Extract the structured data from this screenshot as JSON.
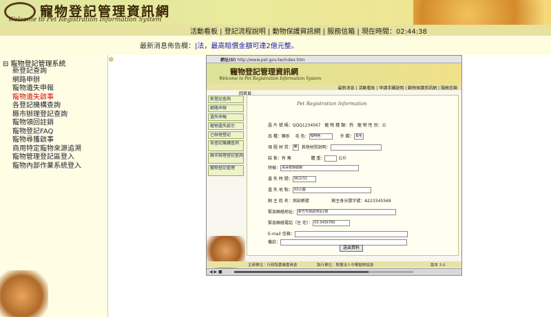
{
  "site": {
    "title": "寵物登記管理資訊網",
    "subtitle": "Welcome to Pet Registration Information System"
  },
  "nav": {
    "items": [
      "活動看板",
      "登記流程說明",
      "動物保護資訊網",
      "服務信箱"
    ],
    "time_label": "現在時間：",
    "time_value": "02:44:38"
  },
  "ticker": {
    "label": "最新消息佈告欄：",
    "message": "|法，最高賠償金額可達2億元整。"
  },
  "sidebar": {
    "root": "寵物登記管理系統",
    "items": [
      {
        "label": "新登記查詢",
        "active": false
      },
      {
        "label": "網路申辦",
        "active": false
      },
      {
        "label": "寵物遺失申報",
        "active": false
      },
      {
        "label": "寵物遺失啟事",
        "active": true
      },
      {
        "label": "各登記機構查詢",
        "active": false
      },
      {
        "label": "縣市辦理登記查詢",
        "active": false
      },
      {
        "label": "寵物領回註銷",
        "active": false
      },
      {
        "label": "寵物登記FAQ",
        "active": false
      },
      {
        "label": "寵物尋獲啟事",
        "active": false
      },
      {
        "label": "商用特定寵物來源追溯",
        "active": false
      },
      {
        "label": "寵物管理登記區登入",
        "active": false
      },
      {
        "label": "寵物內部作業系統登入",
        "active": false
      }
    ]
  },
  "shot": {
    "url_label": "網址(D)",
    "url": "http://www.pet.gov.tw/index.htm",
    "title": "寵物登記管理資訊網",
    "subtitle": "Welcome to Pet Registration Information System",
    "nav": "最新消息 | 活動看板 | 申請手續說明 | 動物保護資訊網 | 服務信箱",
    "tab": "回首頁",
    "menu": [
      "新登記查詢",
      "網路申辦",
      "遺失申報",
      "寵物遺失啟示",
      "已辦理登記",
      "各登記機構查詢",
      "縣市辦理登記查詢",
      "寵物登記管理"
    ],
    "form_title": "Pet Registration Information",
    "fields": {
      "chip_label": "晶 片 號 碼：",
      "chip_value": "QQQ1234567",
      "species_label": "寵 物 種 類：",
      "species_value": "狗",
      "gender_label": "寵 物 性 別：",
      "gender_value": "公",
      "breed_label": "品 種：",
      "breed_value": "歸系",
      "color_label": "毛 色：",
      "color_value": "咖啡色",
      "shape_label": "外 觀：",
      "shape_value": "長毛",
      "collar_label": "項 圈 材 質：",
      "collar_value": "無",
      "collar_desc_label": "其他材質說明：",
      "neutered_label": "結 紮：",
      "neutered_options": "有 無",
      "weight_label": "體 重：",
      "weight_unit": "公斤",
      "features_label": "特徵：",
      "features_value": "耳朵有缺縫線",
      "lost_time_label": "遺 失 時 間：",
      "lost_time_value": "96/2/31",
      "lost_place_label": "遺 失 地 點：",
      "lost_place_value": "XX公園",
      "owner_label": "飼 主 姓 名：",
      "owner_value": "測試帳號",
      "owner_id_label": "飼主身分證字號：",
      "owner_id_value": "A223345569",
      "address_label": "緊急聯絡地址：",
      "address_value": "新竹市測試地址1號",
      "phone_label": "緊急聯絡電話（住 宅）：",
      "phone_value": "03-3456789",
      "email_label": "E-mail 信箱：",
      "note_label": "備註："
    },
    "submit": "送出資料",
    "footer_left": "主辦單位：行政院農業委員會",
    "footer_mid": "執行單位：財團法人中華動物協會",
    "footer_right": "版本 3.0"
  },
  "media": {
    "progress": 0.75
  }
}
